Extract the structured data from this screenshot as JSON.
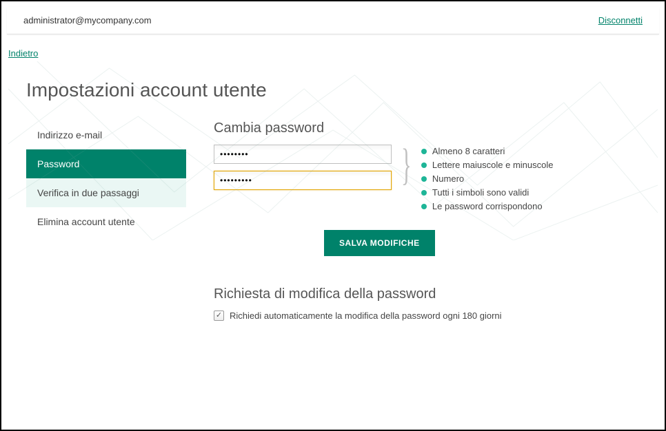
{
  "header": {
    "user_email": "administrator@mycompany.com",
    "logout_label": "Disconnetti"
  },
  "back_label": "Indietro",
  "page_title": "Impostazioni account utente",
  "sidebar": {
    "items": [
      {
        "label": "Indirizzo e-mail"
      },
      {
        "label": "Password"
      },
      {
        "label": "Verifica in due passaggi"
      },
      {
        "label": "Elimina account utente"
      }
    ]
  },
  "password_section": {
    "title": "Cambia password",
    "input1_value": "••••••••",
    "input2_value": "•••••••••",
    "rules": [
      "Almeno 8 caratteri",
      "Lettere maiuscole e minuscole",
      "Numero",
      "Tutti i simboli sono validi",
      "Le password corrispondono"
    ],
    "save_label": "SALVA MODIFICHE"
  },
  "request_section": {
    "title": "Richiesta di modifica della password",
    "checkbox_label": "Richiedi automaticamente la modifica della password ogni 180 giorni",
    "checked": true
  }
}
